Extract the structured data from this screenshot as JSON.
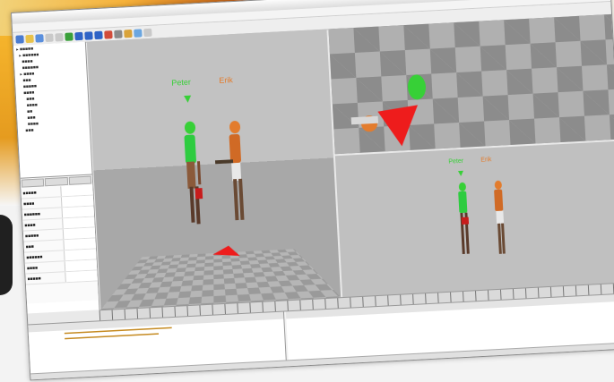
{
  "characters": [
    {
      "name": "Peter",
      "color": "#3fcf3f"
    },
    {
      "name": "Erik",
      "color": "#e0702a"
    }
  ],
  "colors": {
    "peter_green": "#37d037",
    "erik_orange": "#e37c2d",
    "gizmo_red": "#ee1c1c"
  },
  "icons": [
    "new-file-icon",
    "open-icon",
    "save-icon",
    "undo-icon",
    "redo-icon",
    "play-icon",
    "stop-icon",
    "camera-icon",
    "grid-icon",
    "light-icon"
  ]
}
